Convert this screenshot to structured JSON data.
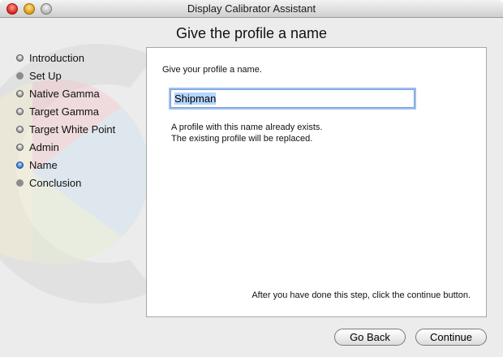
{
  "window": {
    "title": "Display Calibrator Assistant"
  },
  "heading": "Give the profile a name",
  "steps": [
    {
      "label": "Introduction",
      "state": "done"
    },
    {
      "label": "Set Up",
      "state": "todo"
    },
    {
      "label": "Native Gamma",
      "state": "done"
    },
    {
      "label": "Target Gamma",
      "state": "done"
    },
    {
      "label": "Target White Point",
      "state": "done"
    },
    {
      "label": "Admin",
      "state": "done"
    },
    {
      "label": "Name",
      "state": "current"
    },
    {
      "label": "Conclusion",
      "state": "todo"
    }
  ],
  "panel": {
    "prompt": "Give your profile a name.",
    "name_value": "Shipman",
    "warning_line1": "A profile with this name already exists.",
    "warning_line2": "The existing profile will be replaced.",
    "instruction": "After you have done this step, click the continue button."
  },
  "buttons": {
    "back": "Go Back",
    "continue": "Continue"
  }
}
